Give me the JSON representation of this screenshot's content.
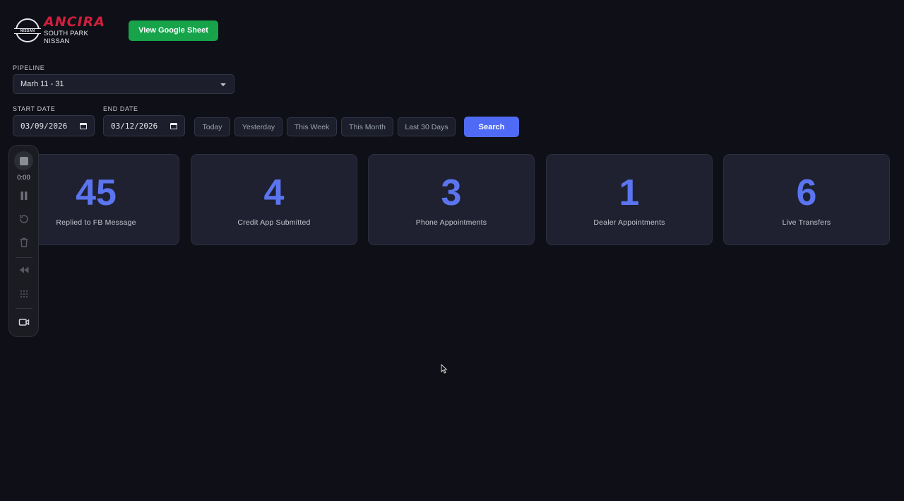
{
  "header": {
    "logo_badge_text": "NISSAN",
    "logo_brand": "ANCIRA",
    "logo_subtitle": "SOUTH PARK NISSAN",
    "google_sheet_button": "View Google Sheet"
  },
  "pipeline": {
    "label": "PIPELINE",
    "selected": "Marh 11 - 31"
  },
  "filters": {
    "start_label": "START DATE",
    "start_value": "03/09/2026",
    "end_label": "END DATE",
    "end_value": "03/12/2026",
    "quick_ranges": [
      "Today",
      "Yesterday",
      "This Week",
      "This Month",
      "Last 30 Days"
    ],
    "search_label": "Search"
  },
  "stats": [
    {
      "value": "45",
      "label": "Replied to FB Message"
    },
    {
      "value": "4",
      "label": "Credit App Submitted"
    },
    {
      "value": "3",
      "label": "Phone Appointments"
    },
    {
      "value": "1",
      "label": "Dealer Appointments"
    },
    {
      "value": "6",
      "label": "Live Transfers"
    }
  ],
  "recorder": {
    "time": "0:00",
    "icons": [
      "stop-icon",
      "pause-icon",
      "restart-icon",
      "trash-icon",
      "rewind-icon",
      "grid-icon",
      "video-camera-icon"
    ]
  },
  "colors": {
    "background": "#0f1017",
    "card": "#1f2130",
    "accent": "#5b75f0",
    "search_button": "#4f6bf5",
    "google_button": "#16a34a",
    "brand_red": "#cf1f3c"
  }
}
